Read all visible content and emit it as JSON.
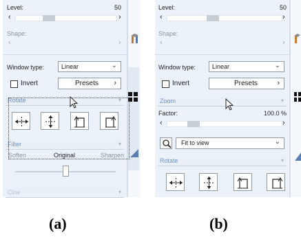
{
  "panel_a": {
    "level_label": "Level:",
    "level_value": "50",
    "level_fraction": 0.5,
    "shape_label": "Shape:",
    "window_type_label": "Window type:",
    "window_type_value": "Linear",
    "invert_label": "Invert",
    "invert_checked": false,
    "presets_label": "Presets",
    "rotate_section": "Rotate",
    "filter_section": "Filter",
    "soften_label": "Soften",
    "original_label": "Original",
    "sharpen_label": "Sharpen",
    "filter_fraction": 0.5,
    "cine_section": "Cine",
    "caption": "(a)"
  },
  "panel_b": {
    "level_label": "Level:",
    "level_value": "50",
    "level_fraction": 0.5,
    "shape_label": "Shape:",
    "window_type_label": "Window type:",
    "window_type_value": "Linear",
    "invert_label": "Invert",
    "invert_checked": false,
    "presets_label": "Presets",
    "zoom_section": "Zoom",
    "factor_label": "Factor:",
    "factor_value": "100.0 %",
    "zoom_mode_value": "Fit to view",
    "rotate_section": "Rotate",
    "caption": "(b)"
  },
  "icons": {
    "flip_horizontal": "flip-horizontal-icon",
    "flip_vertical": "flip-vertical-icon",
    "rotate_left": "rotate-left-icon",
    "rotate_right": "rotate-right-icon",
    "magnifier": "magnifier-icon",
    "grid": "grid-icon",
    "wrench": "wrench-icon",
    "pointer": "mouse-pointer-icon"
  },
  "colors": {
    "panel_bg": "#ecf2fa",
    "section_text": "#6a8fc1",
    "drag_outline": "#3a3a3a"
  }
}
